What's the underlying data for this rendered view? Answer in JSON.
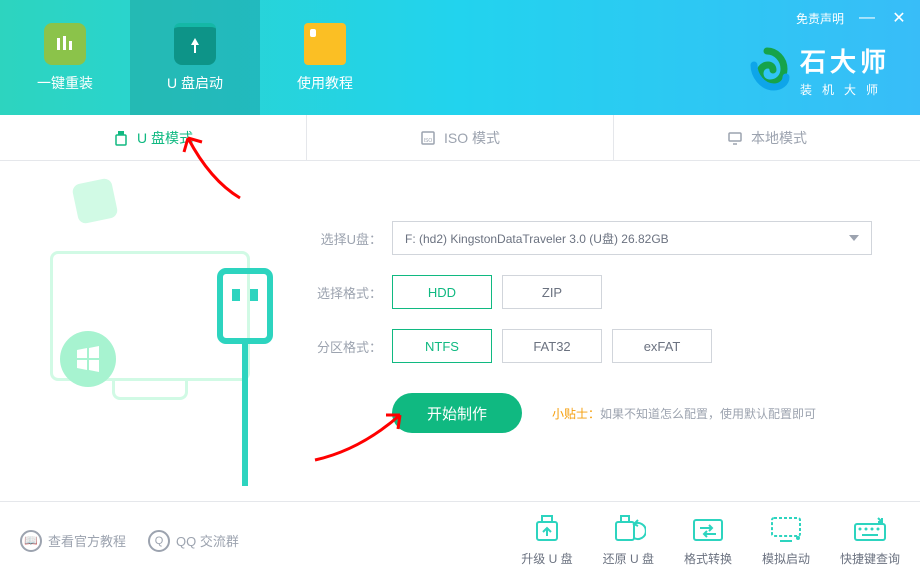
{
  "header": {
    "disclaimer": "免责声明",
    "nav": [
      {
        "label": "一键重装"
      },
      {
        "label": "U 盘启动"
      },
      {
        "label": "使用教程"
      }
    ],
    "brand_title": "石大师",
    "brand_sub": "装机大师"
  },
  "tabs": [
    {
      "label": "U 盘模式",
      "icon": "usb"
    },
    {
      "label": "ISO 模式",
      "icon": "iso"
    },
    {
      "label": "本地模式",
      "icon": "local"
    }
  ],
  "form": {
    "disk_label": "选择U盘：",
    "disk_value": "F: (hd2) KingstonDataTraveler 3.0 (U盘) 26.82GB",
    "format_label": "选择格式：",
    "format_options": [
      "HDD",
      "ZIP"
    ],
    "partition_label": "分区格式：",
    "partition_options": [
      "NTFS",
      "FAT32",
      "exFAT"
    ],
    "start_button": "开始制作",
    "tip_label": "小贴士：",
    "tip_text": "如果不知道怎么配置，使用默认配置即可"
  },
  "footer": {
    "links": [
      {
        "label": "查看官方教程"
      },
      {
        "label": "QQ 交流群"
      }
    ],
    "tools": [
      {
        "label": "升级 U 盘"
      },
      {
        "label": "还原 U 盘"
      },
      {
        "label": "格式转换"
      },
      {
        "label": "模拟启动"
      },
      {
        "label": "快捷键查询"
      }
    ]
  }
}
